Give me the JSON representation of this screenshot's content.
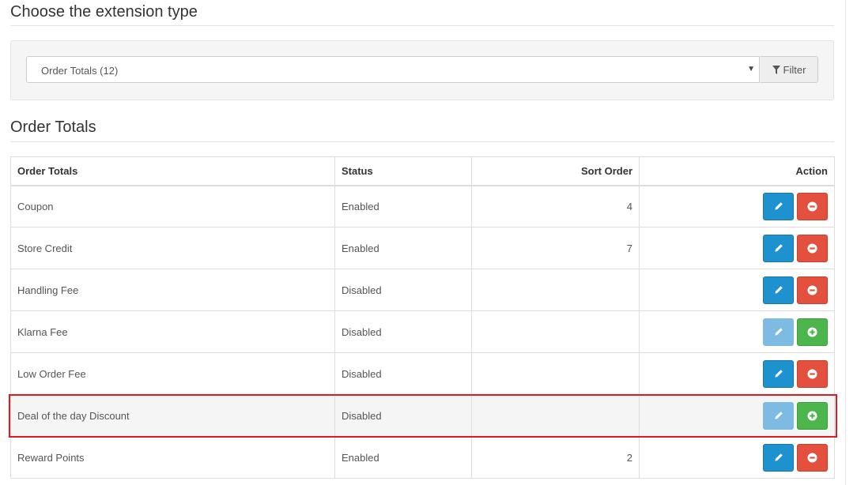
{
  "extension_type": {
    "title": "Choose the extension type",
    "select_value": "Order Totals (12)",
    "filter_label": "Filter"
  },
  "section": {
    "title": "Order Totals"
  },
  "table": {
    "headers": {
      "name": "Order Totals",
      "status": "Status",
      "sort_order": "Sort Order",
      "action": "Action"
    },
    "rows": [
      {
        "name": "Coupon",
        "status": "Enabled",
        "sort_order": "4",
        "installed": true
      },
      {
        "name": "Store Credit",
        "status": "Enabled",
        "sort_order": "7",
        "installed": true
      },
      {
        "name": "Handling Fee",
        "status": "Disabled",
        "sort_order": "",
        "installed": true
      },
      {
        "name": "Klarna Fee",
        "status": "Disabled",
        "sort_order": "",
        "installed": false
      },
      {
        "name": "Low Order Fee",
        "status": "Disabled",
        "sort_order": "",
        "installed": true
      },
      {
        "name": "Deal of the day Discount",
        "status": "Disabled",
        "sort_order": "",
        "installed": false,
        "highlighted": true
      },
      {
        "name": "Reward Points",
        "status": "Enabled",
        "sort_order": "2",
        "installed": true
      }
    ]
  },
  "icons": {
    "filter": "filter-icon",
    "edit": "pencil-icon",
    "uninstall": "minus-circle-icon",
    "install": "plus-circle-icon",
    "dropdown": "caret-down-icon"
  },
  "colors": {
    "primary": "#1e91cf",
    "danger": "#e3503e",
    "success": "#4cb64c",
    "highlight_border": "#e0191f"
  }
}
